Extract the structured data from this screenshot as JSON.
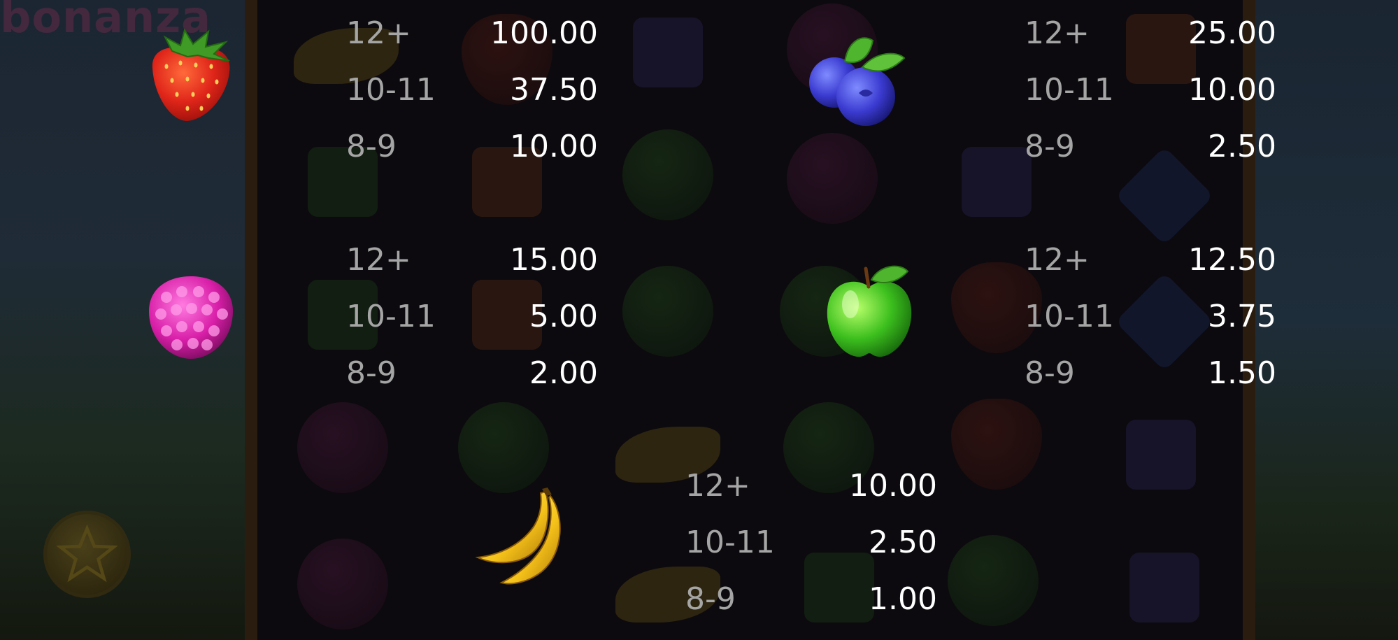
{
  "logo_fragment": "bonanza",
  "paytable": [
    {
      "symbol": "strawberry",
      "rows": [
        {
          "count": "12+",
          "payout": "100.00"
        },
        {
          "count": "10-11",
          "payout": "37.50"
        },
        {
          "count": "8-9",
          "payout": "10.00"
        }
      ]
    },
    {
      "symbol": "blueberry",
      "rows": [
        {
          "count": "12+",
          "payout": "25.00"
        },
        {
          "count": "10-11",
          "payout": "10.00"
        },
        {
          "count": "8-9",
          "payout": "2.50"
        }
      ]
    },
    {
      "symbol": "raspberry",
      "rows": [
        {
          "count": "12+",
          "payout": "15.00"
        },
        {
          "count": "10-11",
          "payout": "5.00"
        },
        {
          "count": "8-9",
          "payout": "2.00"
        }
      ]
    },
    {
      "symbol": "apple",
      "rows": [
        {
          "count": "12+",
          "payout": "12.50"
        },
        {
          "count": "10-11",
          "payout": "3.75"
        },
        {
          "count": "8-9",
          "payout": "1.50"
        }
      ]
    },
    {
      "symbol": "banana",
      "rows": [
        {
          "count": "12+",
          "payout": "10.00"
        },
        {
          "count": "10-11",
          "payout": "2.50"
        },
        {
          "count": "8-9",
          "payout": "1.00"
        }
      ]
    }
  ],
  "colors": {
    "count_text": "#a5a5a5",
    "payout_text": "#ffffff",
    "background": "#0a090b"
  },
  "icons": [
    "strawberry-icon",
    "blueberry-icon",
    "raspberry-icon",
    "apple-icon",
    "banana-icon",
    "star-coin-icon"
  ]
}
